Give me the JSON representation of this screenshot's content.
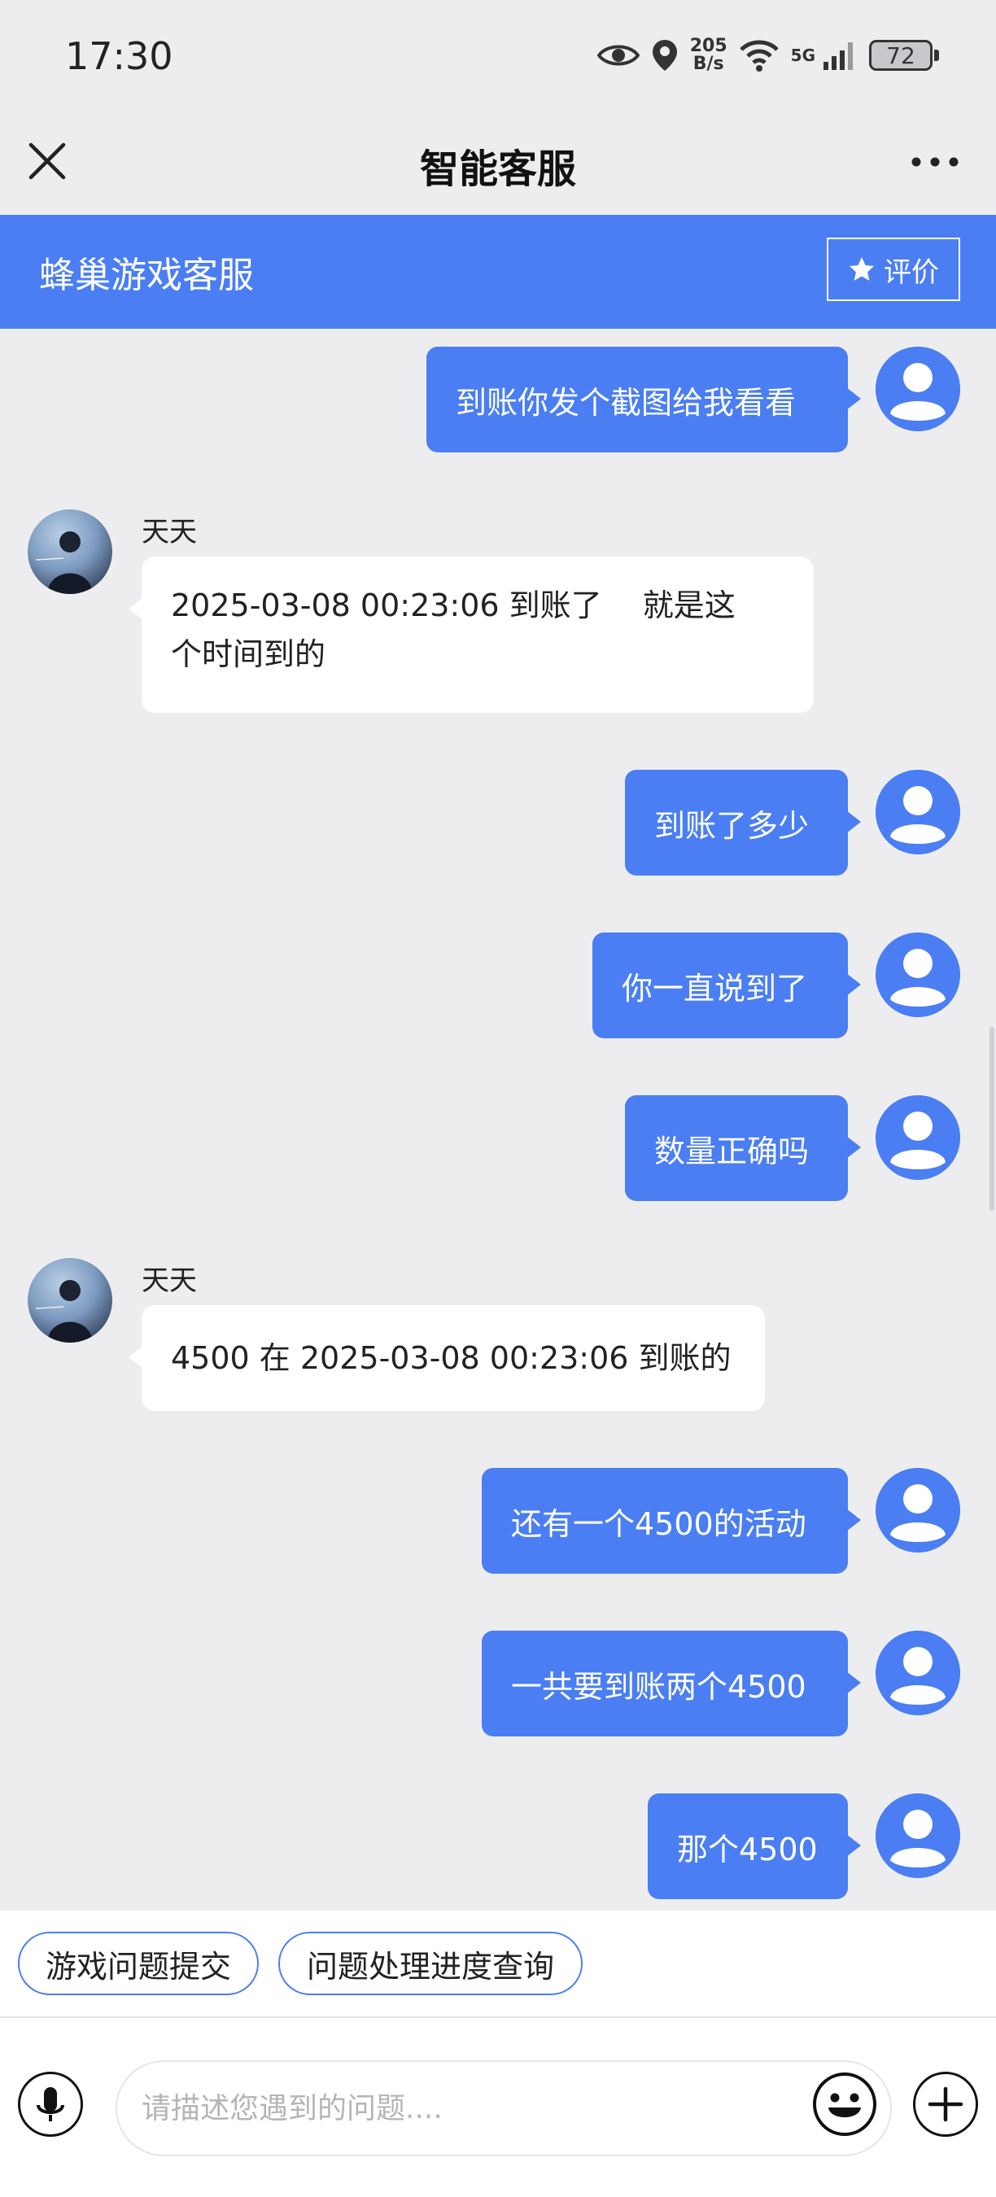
{
  "status": {
    "time": "17:30",
    "speed_value": "205",
    "speed_unit": "B/s",
    "network": "5G",
    "battery": "72"
  },
  "nav": {
    "title": "智能客服"
  },
  "band": {
    "title": "蜂巢游戏客服",
    "rate_label": "评价"
  },
  "messages": [
    {
      "from": "me",
      "text": "到账你发个截图给我看看"
    },
    {
      "from": "agent",
      "name": "天天",
      "text_line1": "2025-03-08 00:23:06 到账了　 就是这",
      "text_line2": "个时间到的"
    },
    {
      "from": "me",
      "text": "到账了多少"
    },
    {
      "from": "me",
      "text": "你一直说到了"
    },
    {
      "from": "me",
      "text": "数量正确吗"
    },
    {
      "from": "agent",
      "name": "天天",
      "text_line1": "4500 在 2025-03-08 00:23:06 到账的"
    },
    {
      "from": "me",
      "text": "还有一个4500的活动"
    },
    {
      "from": "me",
      "text": "一共要到账两个4500"
    },
    {
      "from": "me",
      "text": "那个4500"
    }
  ],
  "quick_actions": [
    "游戏问题提交",
    "问题处理进度查询"
  ],
  "input": {
    "placeholder": "请描述您遇到的问题...."
  },
  "colors": {
    "accent": "#4a7ef2",
    "background": "#ededf0"
  }
}
